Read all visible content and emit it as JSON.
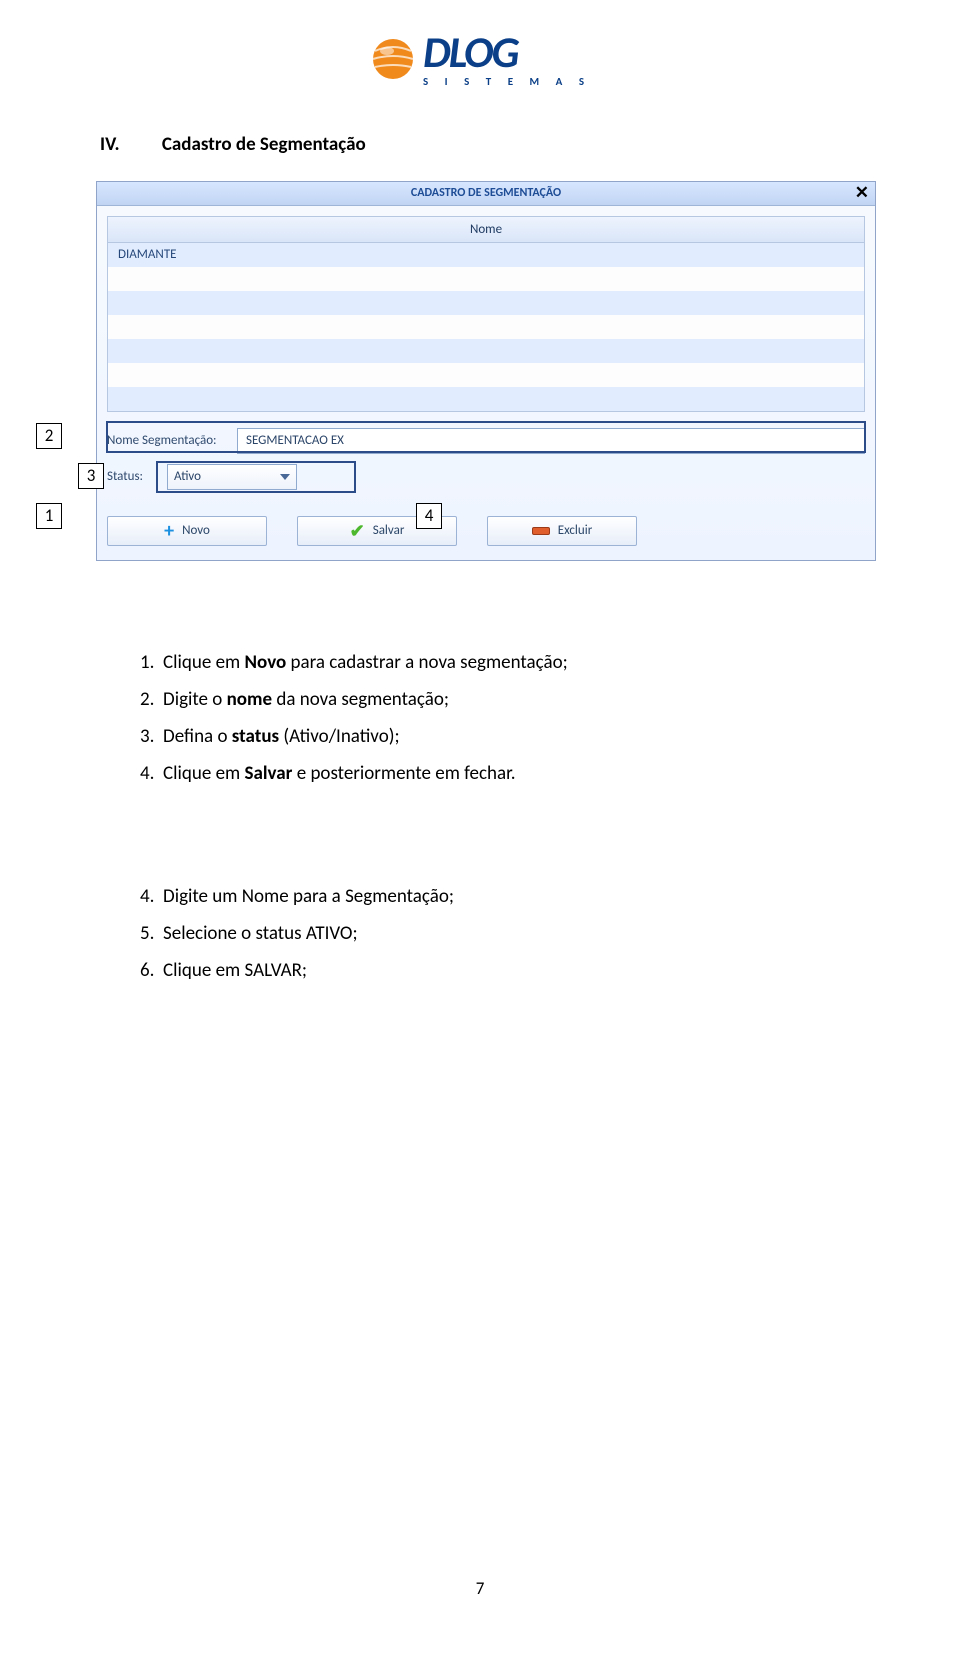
{
  "logo": {
    "main": "DLOG",
    "sub": "S I S T E M A S"
  },
  "heading": {
    "roman": "IV.",
    "title": "Cadastro de Segmentação"
  },
  "window": {
    "title": "CADASTRO DE SEGMENTAÇÃO",
    "grid_header": "Nome",
    "row1": "DIAMANTE",
    "field_name_label": "Nome Segmentação:",
    "field_name_value": "SEGMENTACAO EX",
    "field_status_label": "Status:",
    "field_status_value": "Ativo",
    "btn_novo": "Novo",
    "btn_salvar": "Salvar",
    "btn_excluir": "Excluir"
  },
  "callouts": {
    "c1": "1",
    "c2": "2",
    "c3": "3",
    "c4": "4"
  },
  "instructions1": {
    "i1_num": "1.",
    "i1_a": "Clique em ",
    "i1_b": "Novo",
    "i1_c": " para cadastrar a nova segmentação;",
    "i2_num": "2.",
    "i2_a": "Digite o ",
    "i2_b": "nome",
    "i2_c": " da nova segmentação;",
    "i3_num": "3.",
    "i3_a": "Defina o ",
    "i3_b": "status",
    "i3_c": " (Ativo/Inativo);",
    "i4_num": "4.",
    "i4_a": "Clique em ",
    "i4_b": "Salvar",
    "i4_c": " e posteriormente em fechar."
  },
  "instructions2": {
    "i4_num": "4.",
    "i4": "Digite um Nome para a Segmentação;",
    "i5_num": "5.",
    "i5": "Selecione o status ATIVO;",
    "i6_num": "6.",
    "i6": "Clique em SALVAR;"
  },
  "page_number": "7"
}
